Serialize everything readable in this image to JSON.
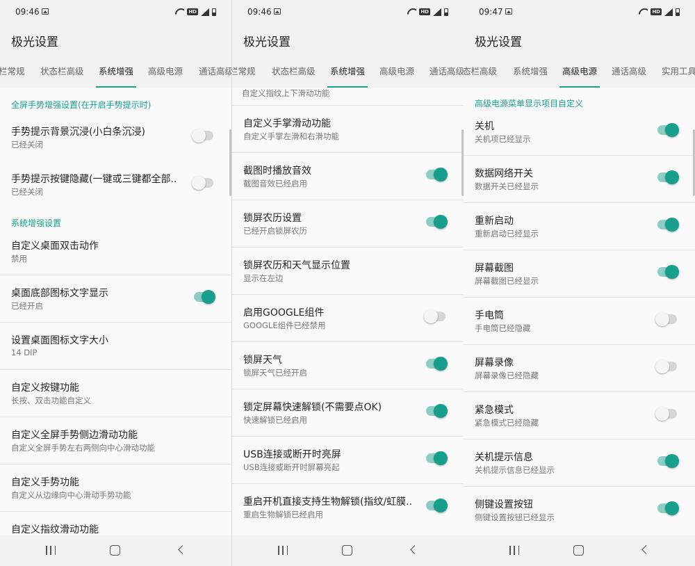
{
  "panels": [
    {
      "status_time": "09:46",
      "app_title": "极光设置",
      "tabs": [
        "栏常规",
        "状态栏高级",
        "系统增强",
        "高级电源",
        "通话高级"
      ],
      "items": [
        {
          "type": "header",
          "text": "全屏手势增强设置(在开启手势提示时)"
        },
        {
          "type": "setting",
          "title": "手势提示背景沉浸(小白条沉浸)",
          "subtitle": "已经关闭",
          "switch": "off"
        },
        {
          "type": "setting",
          "title": "手势提示按键隐藏(一键或三键都全部..",
          "subtitle": "已经关闭",
          "switch": "off"
        },
        {
          "type": "header",
          "text": "系统增强设置"
        },
        {
          "type": "setting",
          "title": "自定义桌面双击动作",
          "subtitle": "禁用"
        },
        {
          "type": "setting",
          "title": "桌面底部图标文字显示",
          "subtitle": "已经开启",
          "switch": "on"
        },
        {
          "type": "setting",
          "title": "设置桌面图标文字大小",
          "subtitle": "14 DIP"
        },
        {
          "type": "setting",
          "title": "自定义按键功能",
          "subtitle": "长按、双击功能自定义"
        },
        {
          "type": "setting",
          "title": "自定义全屏手势侧边滑动功能",
          "subtitle": "自定义全屏手势左右两侧向中心滑动功能"
        },
        {
          "type": "setting",
          "title": "自定义手势功能",
          "subtitle": "自定义从边缘向中心滑动手势功能"
        },
        {
          "type": "setting",
          "title": "自定义指纹滑动功能",
          "subtitle": ""
        }
      ]
    },
    {
      "status_time": "09:46",
      "app_title": "极光设置",
      "tabs": [
        "栏常规",
        "状态栏高级",
        "系统增强",
        "高级电源",
        "通话高级"
      ],
      "items": [
        {
          "type": "plain",
          "text": "自定义指纹上下滑动功能"
        },
        {
          "type": "setting",
          "title": "自定义手掌滑动功能",
          "subtitle": "自定义手掌左滑和右滑功能"
        },
        {
          "type": "setting",
          "title": "截图时播放音效",
          "subtitle": "截图音效已经启用",
          "switch": "on"
        },
        {
          "type": "setting",
          "title": "锁屏农历设置",
          "subtitle": "已经开启锁屏农历",
          "switch": "on"
        },
        {
          "type": "setting",
          "title": "锁屏农历和天气显示位置",
          "subtitle": "显示在左边"
        },
        {
          "type": "setting",
          "title": "启用GOOGLE组件",
          "subtitle": "GOOGLE组件已经禁用",
          "switch": "off"
        },
        {
          "type": "setting",
          "title": "锁屏天气",
          "subtitle": "锁屏天气已经开启",
          "switch": "on"
        },
        {
          "type": "setting",
          "title": "锁定屏幕快速解锁(不需要点OK)",
          "subtitle": "快速解锁已经启用",
          "switch": "on"
        },
        {
          "type": "setting",
          "title": "USB连接或断开时亮屏",
          "subtitle": "USB连接或断开时屏幕亮起",
          "switch": "on"
        },
        {
          "type": "setting",
          "title": "重启开机直接支持生物解锁(指纹/虹膜..",
          "subtitle": "重启生物解锁已经启用",
          "switch": "on"
        }
      ]
    },
    {
      "status_time": "09:47",
      "app_title": "极光设置",
      "tabs": [
        "态栏高级",
        "系统增强",
        "高级电源",
        "通话高级",
        "实用工具"
      ],
      "items": [
        {
          "type": "header",
          "text": "高级电源菜单显示项目自定义"
        },
        {
          "type": "setting",
          "title": "关机",
          "subtitle": "关机项已经显示",
          "switch": "on"
        },
        {
          "type": "setting",
          "title": "数据网络开关",
          "subtitle": "数据开关已经显示",
          "switch": "on"
        },
        {
          "type": "setting",
          "title": "重新启动",
          "subtitle": "重新启动已经显示",
          "switch": "on"
        },
        {
          "type": "setting",
          "title": "屏幕截图",
          "subtitle": "屏幕截图已经显示",
          "switch": "on"
        },
        {
          "type": "setting",
          "title": "手电筒",
          "subtitle": "手电筒已经隐藏",
          "switch": "off"
        },
        {
          "type": "setting",
          "title": "屏幕录像",
          "subtitle": "屏幕录像已经隐藏",
          "switch": "off"
        },
        {
          "type": "setting",
          "title": "紧急模式",
          "subtitle": "紧急模式已经隐藏",
          "switch": "off"
        },
        {
          "type": "setting",
          "title": "关机提示信息",
          "subtitle": "关机提示信息已经显示",
          "switch": "on"
        },
        {
          "type": "setting",
          "title": "侧键设置按钮",
          "subtitle": "侧键设置按钮已经显示",
          "switch": "on"
        }
      ]
    }
  ],
  "icons": {
    "status": [
      "image-icon",
      "wifi-icon",
      "hd-icon",
      "signal-icon",
      "battery-icon"
    ],
    "nav": [
      "recent-apps-icon",
      "home-icon",
      "back-icon"
    ]
  },
  "status_hd_label": "HD",
  "colors": {
    "accent": "#179f8d",
    "accent_light": "#8ccec5"
  }
}
